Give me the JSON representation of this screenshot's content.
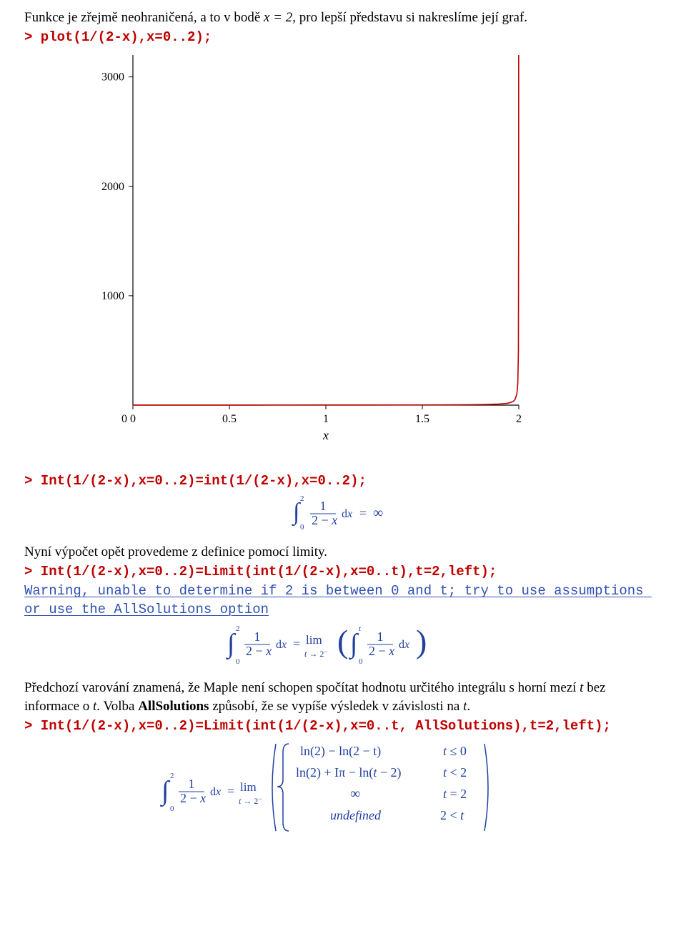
{
  "p1_a": "Funkce je zřejmě neohraničená, a to v bodě ",
  "p1_eq": "x = 2,",
  "p1_b": " pro lepší představu si nakreslíme její graf.",
  "code1": "> plot(1/(2-x),x=0..2);",
  "chart_data": {
    "type": "line",
    "xlabel": "x",
    "ylabel": "",
    "title": "",
    "xlim": [
      0,
      2
    ],
    "ylim": [
      0,
      3200
    ],
    "x_ticks": [
      0,
      0.5,
      1,
      1.5,
      2
    ],
    "y_ticks": [
      0,
      1000,
      2000,
      3000
    ],
    "series": [
      {
        "name": "1/(2-x)",
        "color": "#c00000",
        "x": [
          0,
          0.2,
          0.4,
          0.6,
          0.8,
          1.0,
          1.2,
          1.4,
          1.6,
          1.7,
          1.8,
          1.85,
          1.9,
          1.93,
          1.95,
          1.97,
          1.98,
          1.99,
          1.995,
          1.998,
          1.9995
        ],
        "values": [
          0.5,
          0.556,
          0.625,
          0.714,
          0.833,
          1.0,
          1.25,
          1.667,
          2.5,
          3.333,
          5.0,
          6.667,
          10.0,
          14.29,
          20.0,
          33.33,
          50.0,
          100.0,
          200.0,
          500.0,
          2000.0
        ]
      }
    ]
  },
  "code2": "> Int(1/(2-x),x=0..2)=int(1/(2-x),x=0..2);",
  "eq2": "∫₀² 1/(2−x) dx = ∞",
  "p2": "Nyní výpočet opět provedeme z definice pomocí limity.",
  "code3": "> Int(1/(2-x),x=0..2)=Limit(int(1/(2-x),x=0..t),t=2,left);",
  "warn1": "Warning, unable to determine if 2 is between 0 and t; try to use assumptions or use the AllSolutions option",
  "eq3": "∫₀² 1/(2−x) dx = lim_{t→2⁻} ( ∫₀ᵗ 1/(2−x) dx )",
  "p3_a": "Předchozí varování znamená, že Maple není schopen spočítat hodnotu určitého integrálu s horní mezí ",
  "p3_t1": "t",
  "p3_b": " bez informace o ",
  "p3_t2": "t",
  "p3_c": ". Volba ",
  "p3_bold": "AllSolutions",
  "p3_d": " způsobí, že se vypíše výsledek v závislosti na ",
  "p3_t3": "t",
  "p3_e": ".",
  "code4": "> Int(1/(2-x),x=0..2)=Limit(int(1/(2-x),x=0..t, AllSolutions),t=2,left);",
  "pw": {
    "row1_expr": "ln(2) − ln(2 − t)",
    "row1_cond": "t ≤ 0",
    "row2_expr": "ln(2) + Iπ − ln(t − 2)",
    "row2_cond": "t < 2",
    "row3_expr": "∞",
    "row3_cond": "t = 2",
    "row4_expr": "undefined",
    "row4_cond": "2 < t"
  }
}
